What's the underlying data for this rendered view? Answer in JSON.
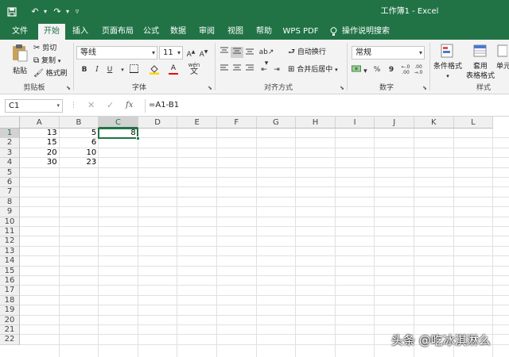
{
  "window": {
    "title": "工作簿1  -  Excel"
  },
  "quick_access": {
    "customize": "▿"
  },
  "tabs": [
    {
      "label": "文件"
    },
    {
      "label": "开始"
    },
    {
      "label": "插入"
    },
    {
      "label": "页面布局"
    },
    {
      "label": "公式"
    },
    {
      "label": "数据"
    },
    {
      "label": "审阅"
    },
    {
      "label": "视图"
    },
    {
      "label": "帮助"
    },
    {
      "label": "WPS PDF"
    },
    {
      "label": "操作说明搜索"
    }
  ],
  "ribbon": {
    "clipboard": {
      "paste": "粘贴",
      "cut": "剪切",
      "copy": "复制",
      "format_painter": "格式刷",
      "label": "剪贴板"
    },
    "font": {
      "name": "等线",
      "size": "11",
      "label": "字体",
      "wen": "wén",
      "wen_char": "文"
    },
    "alignment": {
      "wrap": "自动换行",
      "merge": "合并后居中",
      "label": "对齐方式"
    },
    "number": {
      "format": "常规",
      "label": "数字",
      "percent": "%",
      "comma": "9",
      "inc": ".0\n.00",
      "dec": ".00\n→.0"
    },
    "styles": {
      "conditional": "条件格式",
      "table_format_1": "套用",
      "table_format_2": "表格格式",
      "cell_styles": "单元",
      "label": "样式"
    }
  },
  "formula_bar": {
    "name_box": "C1",
    "fx": "fx",
    "formula": "=A1-B1"
  },
  "sheet": {
    "columns": [
      "A",
      "B",
      "C",
      "D",
      "E",
      "F",
      "G",
      "H",
      "I",
      "J",
      "K",
      "L"
    ],
    "rows": [
      "1",
      "2",
      "3",
      "4",
      "5",
      "6",
      "7",
      "8",
      "9",
      "10",
      "11",
      "12",
      "13",
      "14",
      "15",
      "16",
      "17",
      "18",
      "19",
      "20",
      "21",
      "22"
    ],
    "selected_cell": "C1",
    "cells": [
      {
        "ref": "A1",
        "value": "13"
      },
      {
        "ref": "B1",
        "value": "5"
      },
      {
        "ref": "C1",
        "value": "8"
      },
      {
        "ref": "A2",
        "value": "15"
      },
      {
        "ref": "B2",
        "value": "6"
      },
      {
        "ref": "A3",
        "value": "20"
      },
      {
        "ref": "B3",
        "value": "10"
      },
      {
        "ref": "A4",
        "value": "30"
      },
      {
        "ref": "B4",
        "value": "23"
      }
    ]
  },
  "watermark": "头条 @吃冰淇淋么",
  "colors": {
    "accent": "#217346",
    "ribbon_bg": "#f3f3f3",
    "gridline": "#e1e1e1"
  }
}
